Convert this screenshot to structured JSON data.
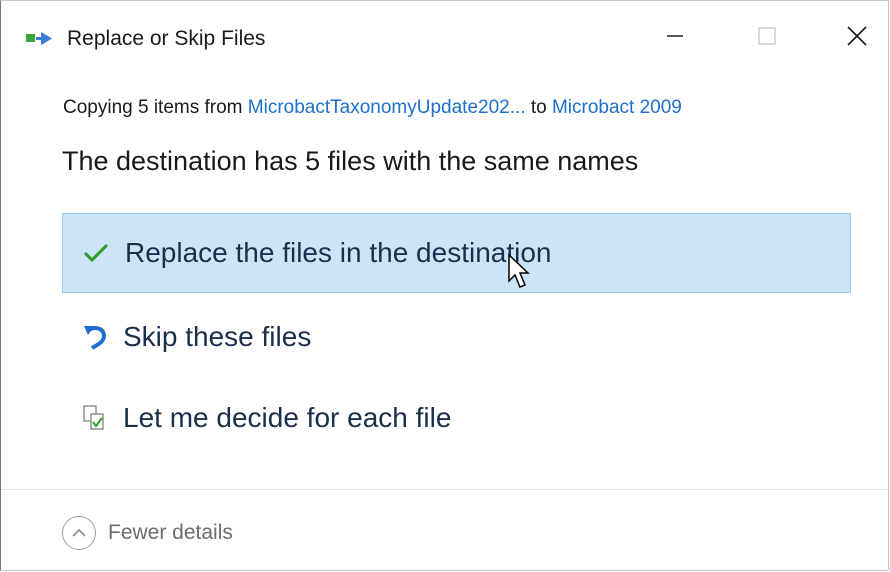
{
  "window": {
    "title": "Replace or Skip Files",
    "icon": "copy-files-icon",
    "controls": {
      "minimize": "minimize-icon",
      "maximize": "maximize-icon",
      "close": "close-icon"
    }
  },
  "copy_info": {
    "prefix": "Copying 5 items from ",
    "source": "MicrobactTaxonomyUpdate202...",
    "middle": " to ",
    "destination": "Microbact 2009"
  },
  "heading": "The destination has 5 files with the same names",
  "options": [
    {
      "label": "Replace the files in the destination",
      "icon": "checkmark-icon",
      "selected": true
    },
    {
      "label": "Skip these files",
      "icon": "skip-arrow-icon",
      "selected": false
    },
    {
      "label": "Let me decide for each file",
      "icon": "compare-files-icon",
      "selected": false
    }
  ],
  "footer": {
    "details_label": "Fewer details",
    "details_icon": "chevron-up-icon"
  },
  "colors": {
    "link": "#1e6fcc",
    "selected_bg": "#cce4f7",
    "selected_border": "#99c9ef",
    "check_green": "#2a9d2a",
    "skip_blue": "#1c6fd1"
  }
}
